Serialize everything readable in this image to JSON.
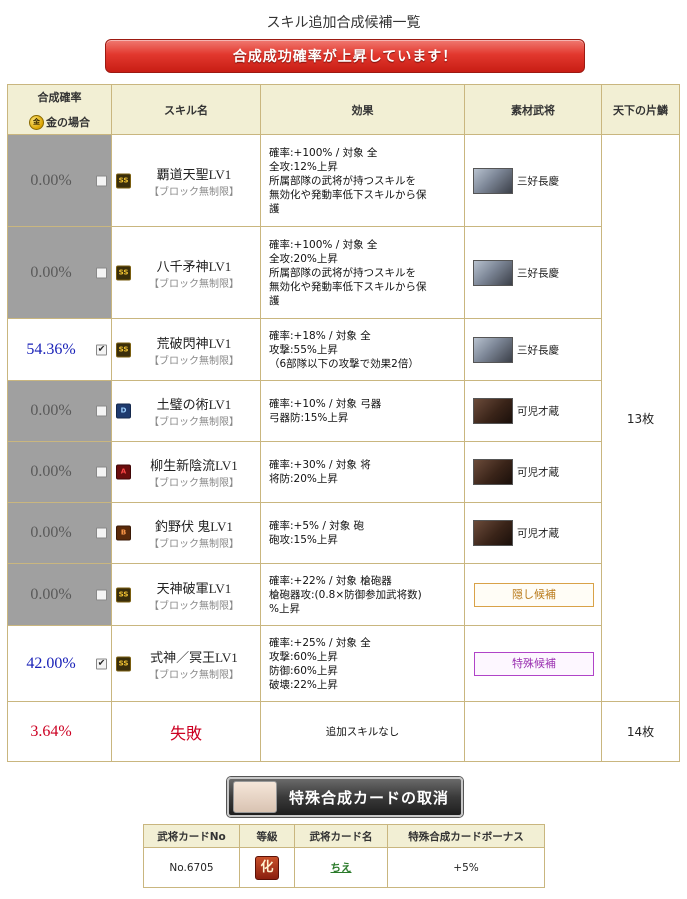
{
  "page": {
    "title": "スキル追加合成候補一覧",
    "banner": "合成成功確率が上昇しています！"
  },
  "table": {
    "headers": {
      "rate": "合成確率",
      "rate_sub": "金の場合",
      "gold_icon": "金",
      "skill": "スキル名",
      "effect": "効果",
      "material": "素材武将",
      "tenka": "天下の片鱗"
    },
    "rows": [
      {
        "rate": "0.00%",
        "checked": false,
        "rank": "SS",
        "name": "覇道天聖LV1",
        "sub": "【ブロック無制限】",
        "effect": [
          "確率:+100% / 対象 全",
          "全攻:12%上昇",
          "所属部隊の武将が持つスキルを",
          "無効化や発動率低下スキルから保",
          "護"
        ],
        "material": "三好長慶"
      },
      {
        "rate": "0.00%",
        "checked": false,
        "rank": "SS",
        "name": "八千矛神LV1",
        "sub": "【ブロック無制限】",
        "effect": [
          "確率:+100% / 対象 全",
          "全攻:20%上昇",
          "所属部隊の武将が持つスキルを",
          "無効化や発動率低下スキルから保",
          "護"
        ],
        "material": "三好長慶"
      },
      {
        "rate": "54.36%",
        "checked": true,
        "rank": "SS",
        "name": "荒破閃神LV1",
        "sub": "【ブロック無制限】",
        "effect": [
          "確率:+18% / 対象 全",
          "攻撃:55%上昇",
          "（6部隊以下の攻撃で効果2倍）"
        ],
        "material": "三好長慶"
      },
      {
        "rate": "0.00%",
        "checked": false,
        "rank": "D",
        "name": "土璧の術LV1",
        "sub": "【ブロック無制限】",
        "effect": [
          "確率:+10% / 対象 弓器",
          "弓器防:15%上昇"
        ],
        "material": "可児才蔵"
      },
      {
        "rate": "0.00%",
        "checked": false,
        "rank": "A",
        "name": "柳生新陰流LV1",
        "sub": "【ブロック無制限】",
        "effect": [
          "確率:+30% / 対象 将",
          "将防:20%上昇"
        ],
        "material": "可児才蔵"
      },
      {
        "rate": "0.00%",
        "checked": false,
        "rank": "B",
        "name": "釣野伏 鬼LV1",
        "sub": "【ブロック無制限】",
        "effect": [
          "確率:+5% / 対象 砲",
          "砲攻:15%上昇"
        ],
        "material": "可児才蔵"
      },
      {
        "rate": "0.00%",
        "checked": false,
        "rank": "SS",
        "name": "天神破軍LV1",
        "sub": "【ブロック無制限】",
        "effect": [
          "確率:+22% / 対象 槍砲器",
          "槍砲器攻:(0.8×防御参加武将数)",
          "%上昇"
        ],
        "material_button": "隠し候補"
      },
      {
        "rate": "42.00%",
        "checked": true,
        "rank": "SS",
        "name": "式神／冥王LV1",
        "sub": "【ブロック無制限】",
        "effect": [
          "確率:+25% / 対象 全",
          "攻撃:60%上昇",
          "防御:60%上昇",
          "破壊:22%上昇"
        ],
        "material_button": "特殊候補"
      }
    ],
    "tenka_main": "13枚",
    "fail": {
      "rate": "3.64%",
      "label": "失敗",
      "effect": "追加スキルなし",
      "tenka": "14枚"
    }
  },
  "cancel_button": "特殊合成カードの取消",
  "card_table": {
    "headers": [
      "武将カードNo",
      "等級",
      "武将カード名",
      "特殊合成カードボーナス"
    ],
    "row": {
      "no": "No.6705",
      "grade": "化",
      "name": "ちえ",
      "bonus": "+5%"
    }
  },
  "colors": {
    "banner_red": "#d42a20",
    "gray_cell": "#a0a0a0",
    "blue_rate": "#1a22b8",
    "red_rate": "#cc0022",
    "border": "#c9b67f",
    "header_bg": "#f2efd4"
  }
}
